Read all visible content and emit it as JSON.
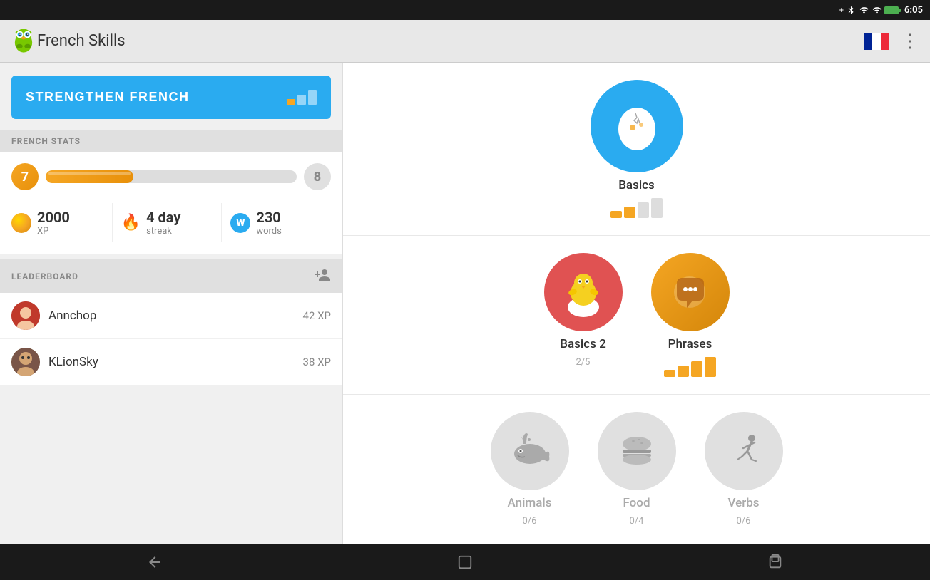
{
  "statusBar": {
    "time": "6:05",
    "icons": [
      "bluetooth",
      "wifi",
      "signal",
      "battery"
    ]
  },
  "appBar": {
    "title": "French Skills",
    "moreLabel": "⋮"
  },
  "leftPanel": {
    "strengthenBtn": {
      "label": "STRENGTHEN FRENCH"
    },
    "frenchStatsLabel": "FRENCH STATS",
    "currentLevel": "7",
    "nextLevel": "8",
    "xpBarPercent": 35,
    "stats": {
      "xp": {
        "value": "2000",
        "label": "XP"
      },
      "streak": {
        "value": "4 day",
        "label": "streak"
      },
      "words": {
        "value": "230",
        "label": "words"
      }
    },
    "leaderboardLabel": "LEADERBOARD",
    "leaderboard": [
      {
        "name": "Annchop",
        "xp": "42 XP"
      },
      {
        "name": "KLionSky",
        "xp": "38 XP"
      }
    ]
  },
  "skills": {
    "row1": [
      {
        "name": "Basics",
        "type": "basics",
        "progress": null,
        "strengthBars": [
          1,
          1,
          0,
          0
        ],
        "locked": false
      }
    ],
    "row2": [
      {
        "name": "Basics 2",
        "type": "basics2",
        "progress": "2/5",
        "strengthBars": null,
        "locked": false
      },
      {
        "name": "Phrases",
        "type": "phrases",
        "progress": null,
        "strengthBars": [
          1,
          1,
          1,
          1
        ],
        "locked": false
      }
    ],
    "row3": [
      {
        "name": "Animals",
        "type": "locked",
        "progress": "0/6",
        "locked": true
      },
      {
        "name": "Food",
        "type": "locked",
        "progress": "0/4",
        "locked": true
      },
      {
        "name": "Verbs",
        "type": "locked",
        "progress": "0/6",
        "locked": true
      }
    ]
  }
}
